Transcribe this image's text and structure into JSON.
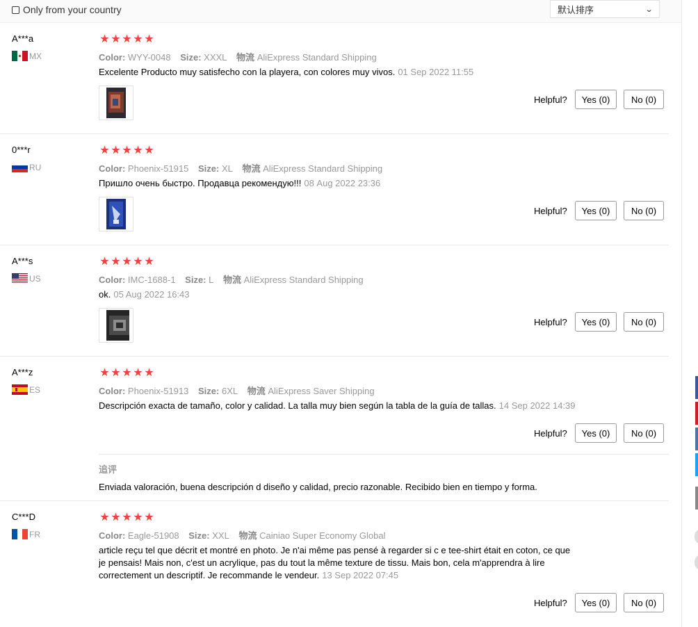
{
  "filter": {
    "only_country_label": "Only from your country"
  },
  "sort": {
    "selected": "默认排序"
  },
  "labels": {
    "color": "Color:",
    "size": "Size:",
    "shipping": "物流",
    "helpful": "Helpful?",
    "append": "追评"
  },
  "reviews": [
    {
      "user": "A***a",
      "country": "MX",
      "stars": 5,
      "color": "WYY-0048",
      "size": "XXXL",
      "shipping": "AliExpress Standard Shipping",
      "text": "Excelente Producto muy satisfecho con la playera, con colores muy vivos.",
      "date": "01 Sep 2022 11:55",
      "yes": "Yes (0)",
      "no": "No (0)"
    },
    {
      "user": "0***r",
      "country": "RU",
      "stars": 5,
      "color": "Phoenix-51915",
      "size": "XL",
      "shipping": "AliExpress Standard Shipping",
      "text": "Пришло очень быстро. Продавца рекомендую!!!",
      "date": "08 Aug 2022 23:36",
      "yes": "Yes (0)",
      "no": "No (0)"
    },
    {
      "user": "A***s",
      "country": "US",
      "stars": 5,
      "color": "IMC-1688-1",
      "size": "L",
      "shipping": "AliExpress Standard Shipping",
      "text": "ok.",
      "date": "05 Aug 2022 16:43",
      "yes": "Yes (0)",
      "no": "No (0)"
    },
    {
      "user": "A***z",
      "country": "ES",
      "stars": 5,
      "color": "Phoenix-51913",
      "size": "6XL",
      "shipping": "AliExpress Saver Shipping",
      "text": "Descripción exacta de tamaño, color y calidad. La talla muy bien según la tabla de la guía de tallas.",
      "date": "14 Sep 2022 14:39",
      "yes": "Yes (0)",
      "no": "No (0)",
      "append_text": "Enviada valoración, buena descripción d diseño y calidad, precio razonable. Recibido bien en tiempo y forma."
    },
    {
      "user": "C***D",
      "country": "FR",
      "stars": 5,
      "color": "Eagle-51908",
      "size": "XXL",
      "shipping": "Cainiao Super Economy Global",
      "text_lines": [
        "article reçu tel que décrit et montré en photo. Je n'ai même pas pensé à regarder si c e tee-shirt était en coton, ce que",
        "je pensais! Mais non, c'est un acrylique, pas du tout la même texture de tissu. Mais bon, cela m'apprendra à lire",
        "correctement un descriptif. Je recommande le vendeur."
      ],
      "date": "13 Sep 2022 07:45",
      "yes": "Yes (0)",
      "no": "No (0)"
    }
  ],
  "colors": {
    "star": "#f44336",
    "muted": "#999999",
    "border": "#e8e8e8"
  }
}
